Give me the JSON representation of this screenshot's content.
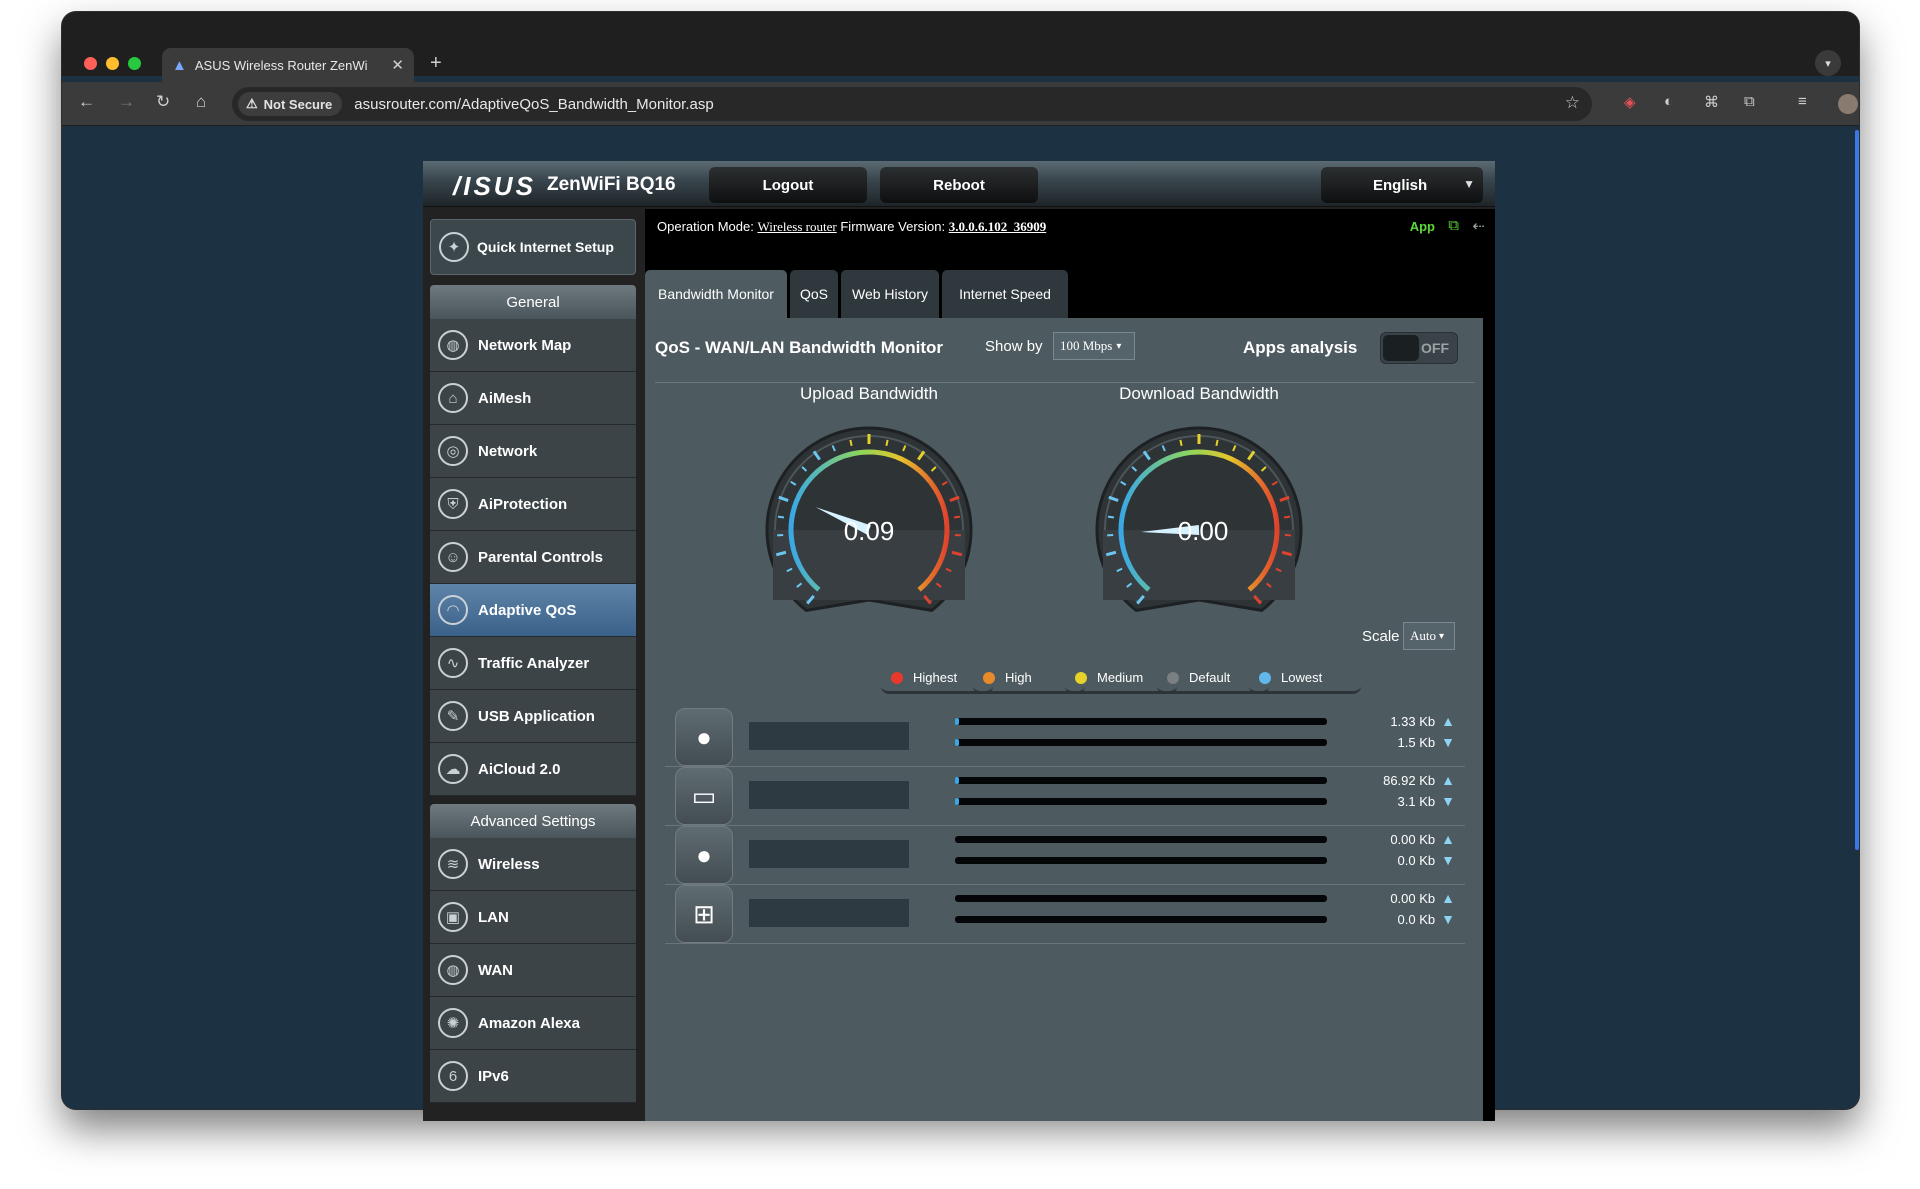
{
  "browser": {
    "tab_title": "ASUS Wireless Router ZenWi",
    "not_secure": "Not Secure",
    "url": "asusrouter.com/AdaptiveQoS_Bandwidth_Monitor.asp"
  },
  "router": {
    "brand": "/ISUS",
    "model": "ZenWiFi BQ16",
    "logout": "Logout",
    "reboot": "Reboot",
    "language": "English",
    "operation_mode_label": "Operation Mode:",
    "operation_mode": "Wireless router",
    "firmware_label": "Firmware Version:",
    "firmware": "3.0.0.6.102_36909",
    "app_label": "App"
  },
  "sidebar": {
    "quick_setup": "Quick Internet Setup",
    "general_header": "General",
    "general": [
      {
        "label": "Network Map",
        "icon": "globe-icon"
      },
      {
        "label": "AiMesh",
        "icon": "mesh-icon"
      },
      {
        "label": "Network",
        "icon": "network-globe-icon"
      },
      {
        "label": "AiProtection",
        "icon": "lock-shield-icon"
      },
      {
        "label": "Parental Controls",
        "icon": "family-icon"
      },
      {
        "label": "Adaptive QoS",
        "icon": "speedometer-icon"
      },
      {
        "label": "Traffic Analyzer",
        "icon": "pulse-icon"
      },
      {
        "label": "USB Application",
        "icon": "usb-icon"
      },
      {
        "label": "AiCloud 2.0",
        "icon": "cloud-icon"
      }
    ],
    "advanced_header": "Advanced Settings",
    "advanced": [
      {
        "label": "Wireless",
        "icon": "wifi-icon"
      },
      {
        "label": "LAN",
        "icon": "lan-icon"
      },
      {
        "label": "WAN",
        "icon": "wan-globe-icon"
      },
      {
        "label": "Amazon Alexa",
        "icon": "alexa-icon"
      },
      {
        "label": "IPv6",
        "icon": "ipv6-icon"
      }
    ]
  },
  "tabs": [
    "Bandwidth Monitor",
    "QoS",
    "Web History",
    "Internet Speed"
  ],
  "monitor": {
    "title": "QoS - WAN/LAN Bandwidth Monitor",
    "show_by_label": "Show by",
    "show_by_value": "100 Mbps",
    "apps_analysis_label": "Apps analysis",
    "apps_analysis_state": "OFF",
    "upload_title": "Upload Bandwidth",
    "download_title": "Download Bandwidth",
    "upload_value": "0.09",
    "download_value": "0.00",
    "scale_label": "Scale",
    "scale_value": "Auto"
  },
  "legend": [
    {
      "label": "Highest",
      "color": "#e8382c"
    },
    {
      "label": "High",
      "color": "#e98a2a"
    },
    {
      "label": "Medium",
      "color": "#e6d22b"
    },
    {
      "label": "Default",
      "color": "#7a7f82"
    },
    {
      "label": "Lowest",
      "color": "#62b8ea"
    }
  ],
  "clients": [
    {
      "icon": "apple-icon",
      "up": "1.33 Kb",
      "down": "1.5 Kb",
      "up_fill": 0.01,
      "down_fill": 0.01
    },
    {
      "icon": "laptop-icon",
      "up": "86.92 Kb",
      "down": "3.1 Kb",
      "up_fill": 0.01,
      "down_fill": 0.01
    },
    {
      "icon": "apple-icon",
      "up": "0.00 Kb",
      "down": "0.0 Kb",
      "up_fill": 0,
      "down_fill": 0
    },
    {
      "icon": "windows-icon",
      "up": "0.00 Kb",
      "down": "0.0 Kb",
      "up_fill": 0,
      "down_fill": 0
    }
  ]
}
